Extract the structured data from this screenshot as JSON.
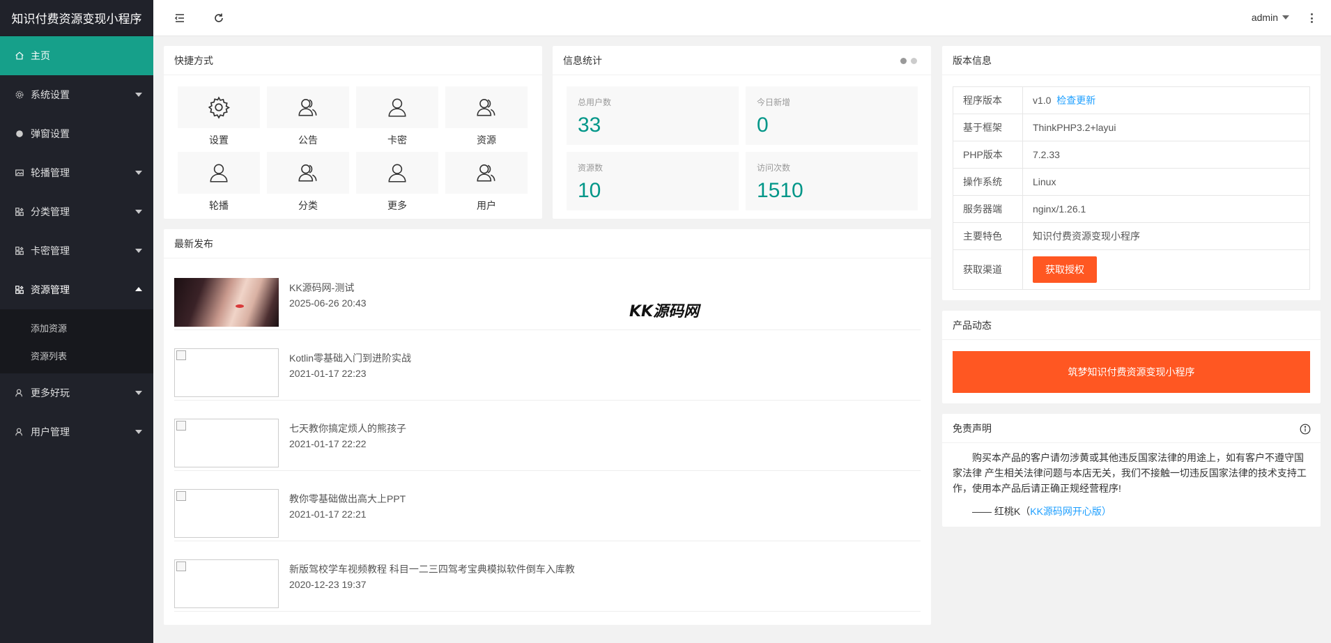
{
  "app": {
    "title": "知识付费资源变现小程序"
  },
  "sidebar": {
    "items": [
      {
        "label": "主页",
        "icon": "home-icon",
        "active": true
      },
      {
        "label": "系统设置",
        "icon": "gear-icon"
      },
      {
        "label": "弹窗设置",
        "icon": "circle-icon"
      },
      {
        "label": "轮播管理",
        "icon": "image-icon"
      },
      {
        "label": "分类管理",
        "icon": "app-icon"
      },
      {
        "label": "卡密管理",
        "icon": "app-icon"
      },
      {
        "label": "资源管理",
        "icon": "app-icon",
        "expanded": true
      },
      {
        "label": "更多好玩",
        "icon": "user-icon"
      },
      {
        "label": "用户管理",
        "icon": "user-icon"
      }
    ],
    "sub_items": [
      {
        "label": "添加资源"
      },
      {
        "label": "资源列表"
      }
    ]
  },
  "header": {
    "user": "admin"
  },
  "shortcuts": {
    "title": "快捷方式",
    "items": [
      {
        "label": "设置",
        "icon": "gear-icon"
      },
      {
        "label": "公告",
        "icon": "users-icon"
      },
      {
        "label": "卡密",
        "icon": "user-icon"
      },
      {
        "label": "资源",
        "icon": "users-icon"
      },
      {
        "label": "轮播",
        "icon": "user-icon"
      },
      {
        "label": "分类",
        "icon": "users-icon"
      },
      {
        "label": "更多",
        "icon": "user-icon"
      },
      {
        "label": "用户",
        "icon": "users-icon"
      }
    ]
  },
  "stats": {
    "title": "信息统计",
    "items": [
      {
        "label": "总用户数",
        "value": "33"
      },
      {
        "label": "今日新增",
        "value": "0"
      },
      {
        "label": "资源数",
        "value": "10"
      },
      {
        "label": "访问次数",
        "value": "1510"
      }
    ]
  },
  "news": {
    "title": "最新发布",
    "watermark": "KK源码网",
    "items": [
      {
        "title": "KK源码网-测试",
        "time": "2025-06-26 20:43",
        "has_image": true
      },
      {
        "title": "Kotlin零基础入门到进阶实战",
        "time": "2021-01-17 22:23",
        "has_image": false
      },
      {
        "title": "七天教你搞定烦人的熊孩子",
        "time": "2021-01-17 22:22",
        "has_image": false
      },
      {
        "title": "教你零基础做出高大上PPT",
        "time": "2021-01-17 22:21",
        "has_image": false
      },
      {
        "title": "新版驾校学车视频教程 科目一二三四驾考宝典模拟软件倒车入库教",
        "time": "2020-12-23 19:37",
        "has_image": false
      }
    ]
  },
  "version": {
    "title": "版本信息",
    "rows": [
      {
        "key": "程序版本",
        "value": "v1.0",
        "link": "检查更新"
      },
      {
        "key": "基于框架",
        "value": "ThinkPHP3.2+layui"
      },
      {
        "key": "PHP版本",
        "value": "7.2.33"
      },
      {
        "key": "操作系统",
        "value": "Linux"
      },
      {
        "key": "服务器端",
        "value": "nginx/1.26.1"
      },
      {
        "key": "主要特色",
        "value": "知识付费资源变现小程序"
      },
      {
        "key": "获取渠道",
        "button": "获取授权"
      }
    ]
  },
  "product": {
    "title": "产品动态",
    "banner": "筑梦知识付费资源变现小程序"
  },
  "disclaimer": {
    "title": "免责声明",
    "text": "购买本产品的客户请勿涉黄或其他违反国家法律的用途上，如有客户不遵守国家法律 产生相关法律问题与本店无关，我们不接触一切违反国家法律的技术支持工作，使用本产品后请正确正规经营程序!",
    "signature_prefix": "—— 红桃K（",
    "signature_link": "KK源码网开心版",
    "signature_suffix": "）"
  },
  "colors": {
    "accent": "#009688",
    "sidebar_active": "#16a08a",
    "orange": "#ff5722",
    "link": "#1e9fff"
  }
}
